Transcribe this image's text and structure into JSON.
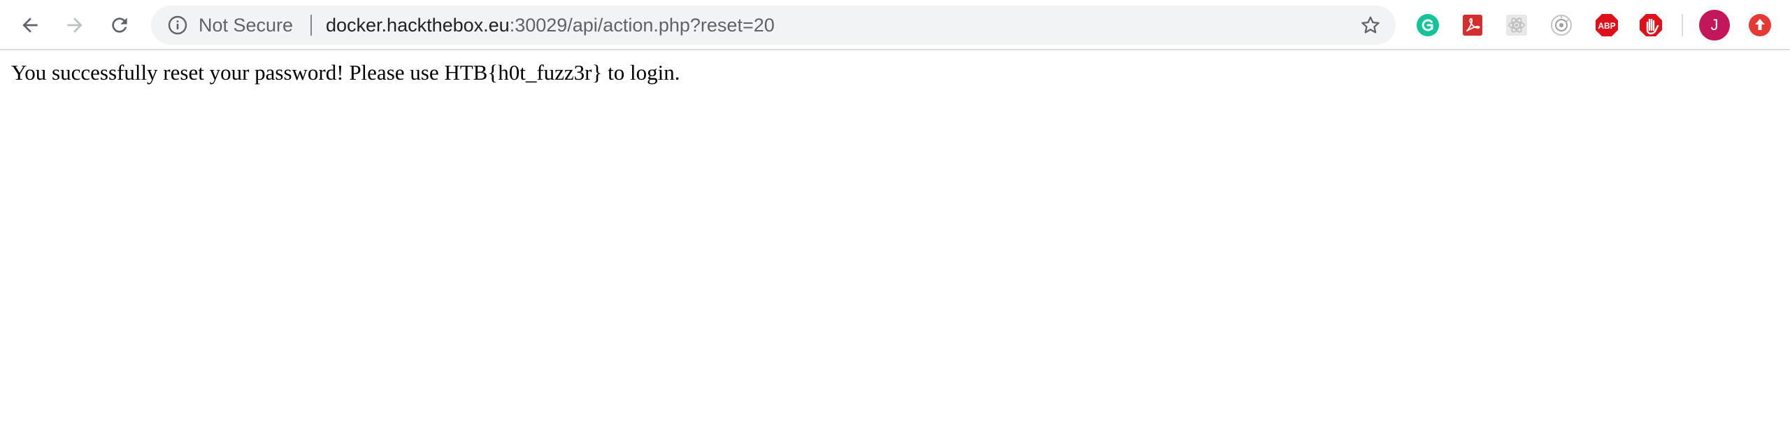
{
  "browser": {
    "security_label": "Not Secure",
    "url_host": "docker.hackthebox.eu",
    "url_rest": ":30029/api/action.php?reset=20",
    "icons": {
      "back": "back-arrow-icon",
      "forward": "forward-arrow-icon",
      "reload": "reload-icon",
      "info": "info-icon",
      "bookmark": "star-icon"
    },
    "extensions": [
      {
        "name": "grammarly",
        "color": "#15c39a",
        "glyph": "G"
      },
      {
        "name": "acrobat",
        "color": "#d32f2f",
        "glyph": ""
      },
      {
        "name": "react-devtools",
        "color": "#bdbdbd",
        "glyph": ""
      },
      {
        "name": "extension-gray",
        "color": "#9e9e9e",
        "glyph": ""
      },
      {
        "name": "adblock-plus",
        "color": "#e0101a",
        "glyph": "ABP"
      },
      {
        "name": "adblock",
        "color": "#e0101a",
        "glyph": ""
      },
      {
        "name": "profile-update",
        "color": "#e53935",
        "glyph": ""
      }
    ],
    "profile_initial": "J",
    "profile_color": "#c2185b"
  },
  "page": {
    "message": "You successfully reset your password! Please use HTB{h0t_fuzz3r} to login."
  }
}
